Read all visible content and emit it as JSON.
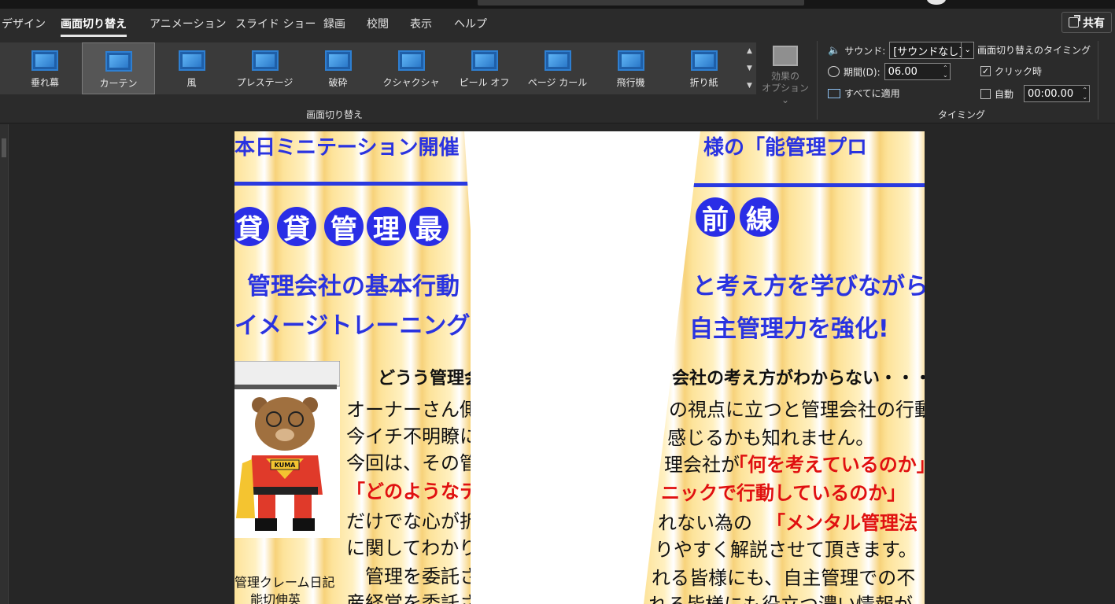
{
  "tabs": [
    {
      "label": "デザイン",
      "active": false
    },
    {
      "label": "画面切り替え",
      "active": true
    },
    {
      "label": "アニメーション",
      "active": false
    },
    {
      "label": "スライド ショー",
      "active": false
    },
    {
      "label": "録画",
      "active": false
    },
    {
      "label": "校閲",
      "active": false
    },
    {
      "label": "表示",
      "active": false
    },
    {
      "label": "ヘルプ",
      "active": false
    }
  ],
  "share_label": "共有",
  "transitions": {
    "items": [
      "垂れ幕",
      "カーテン",
      "風",
      "プレステージ",
      "破砕",
      "クシャクシャ",
      "ピール オフ",
      "ページ カール",
      "飛行機",
      "折り紙"
    ],
    "selected_index": 1,
    "group_label": "画面切り替え"
  },
  "effect_options": {
    "line1": "効果の",
    "line2": "オプション ⌄"
  },
  "timing": {
    "sound_label": "サウンド:",
    "sound_value": "[サウンドなし]",
    "duration_label": "期間(D):",
    "duration_value": "06.00",
    "apply_all": "すべてに適用",
    "advance_title": "画面切り替えのタイミング",
    "on_click_label": "クリック時",
    "on_click_checked": true,
    "auto_label": "自動",
    "auto_checked": false,
    "auto_value": "00:00.00",
    "group_label": "タイミング"
  },
  "slide": {
    "left": {
      "top_banner": "本日ミニテーション開催",
      "circles": [
        "貸",
        "貸",
        "管",
        "理",
        "最"
      ],
      "line1": "管理会社の基本行動",
      "line2": "イメージトレーニングで",
      "heading": "どうう管理会",
      "body1": "オーナーさん側の",
      "body2": "今イチ不明瞭に感",
      "body3": "今回は、その管理",
      "red1": "「どのようなテク",
      "body4": "だけでな心が折",
      "body5": "に関してわかり",
      "body6": "管理を委託され",
      "body7": "産経営を委託され",
      "caption1": "管理クレーム日記",
      "caption2": "能切伸英"
    },
    "right": {
      "top_banner": "様の「能管理プロ",
      "circles": [
        "前",
        "線"
      ],
      "line1": "と考え方を学びながら",
      "line2": "自主管理力を強化!",
      "heading": "会社の考え方がわからない・・・",
      "body1": "の視点に立つと管理会社の行動が",
      "body2": "感じるかも知れません。",
      "body3": "理会社が",
      "red1": "「何を考えているのか」",
      "red2": "ニックで行動しているのか」",
      "body4": "れない為の",
      "red3": "「メンタル管理法",
      "body5": "りやすく解説させて頂きます。",
      "body6": "れる皆様にも、自主管理での不",
      "body7": "れる皆様にも役立つ濃い情報が"
    },
    "bear_badge": "KUMA"
  }
}
